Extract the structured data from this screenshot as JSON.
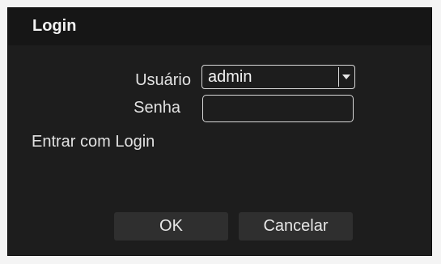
{
  "dialog": {
    "title": "Login"
  },
  "form": {
    "user_label": "Usuário",
    "user_value": "admin",
    "password_label": "Senha",
    "password_value": "",
    "login_mode_label": "Entrar com Login"
  },
  "buttons": {
    "ok_label": "OK",
    "cancel_label": "Cancelar"
  },
  "icons": {
    "dropdown": "chevron-down-icon"
  },
  "colors": {
    "dialog_background": "#1d1d1d",
    "titlebar_background": "#161616",
    "button_background": "#2f2f2f",
    "text": "#e2e2e2",
    "border": "#d8d8d8"
  }
}
